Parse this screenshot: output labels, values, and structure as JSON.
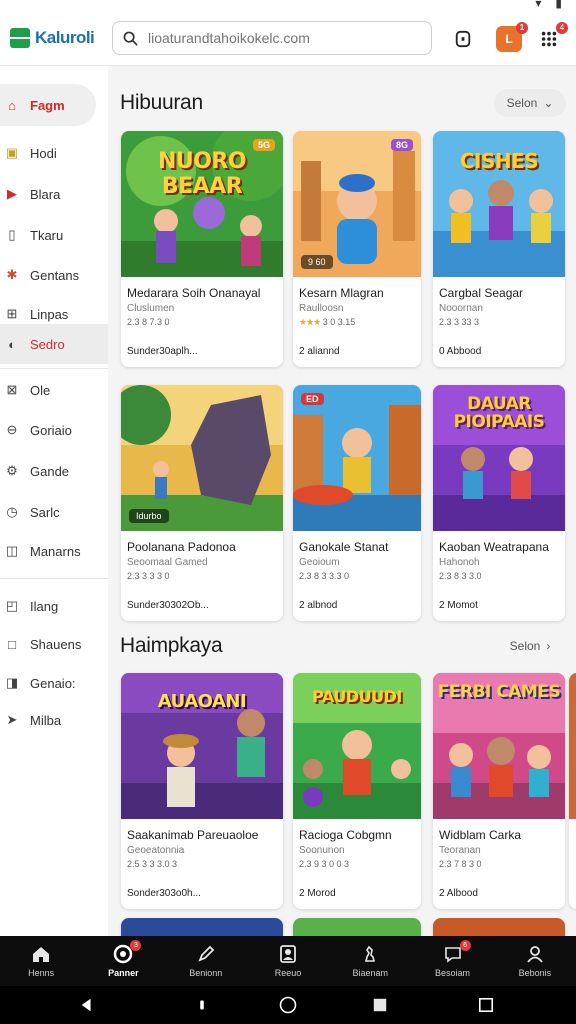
{
  "topbar": {
    "logo_text": "Kaluroli",
    "search_placeholder": "lioaturandtahoikokelc.com",
    "notif_badge": "1",
    "avatar_letter": "L",
    "menu_badge": "4"
  },
  "sidebar": {
    "items": [
      {
        "label": "Fagm",
        "icon": "home-icon"
      },
      {
        "label": "Hodi",
        "icon": "bookmark-icon"
      },
      {
        "label": "Blara",
        "icon": "play-icon"
      },
      {
        "label": "Tkaru",
        "icon": "list-icon"
      },
      {
        "label": "Gentans",
        "icon": "puzzle-icon"
      },
      {
        "label": "Linpas",
        "icon": "grid-icon"
      },
      {
        "label": "Sedro",
        "icon": "eye-icon"
      },
      {
        "label": "Ole",
        "icon": "target-icon"
      },
      {
        "label": "Goriaio",
        "icon": "link-icon"
      },
      {
        "label": "Gande",
        "icon": "gear-icon"
      },
      {
        "label": "Sarlc",
        "icon": "clock-icon"
      },
      {
        "label": "Manarns",
        "icon": "calendar-icon"
      },
      {
        "label": "Ilang",
        "icon": "chart-icon"
      },
      {
        "label": "Shauens",
        "icon": "square-icon"
      },
      {
        "label": "Genaio:",
        "icon": "box-icon"
      },
      {
        "label": "Milba",
        "icon": "send-icon"
      }
    ]
  },
  "sections": [
    {
      "title": "Hibuuran",
      "more_label": "Selon",
      "cards": [
        {
          "thumb_title": "NUORO BEAAR",
          "tag": "5G",
          "title": "Medarara Soih Onanayal",
          "sub": "Cluslumen",
          "rating": "2.3 8 7.3 0",
          "stars": "",
          "foot": "Sunder30aplh..."
        },
        {
          "thumb_title": "",
          "tag": "8G",
          "pill": "9 60",
          "title": "Kesarn Mlagran",
          "sub": "Raulloosn",
          "rating": "3 0 3.15",
          "stars": "★★★",
          "foot": "2 aliannd"
        },
        {
          "thumb_title": "CISHES",
          "tag": "",
          "title": "Cargbal Seagar",
          "sub": "Nooornan",
          "rating": "2.3 3 33 3",
          "stars": "",
          "foot": "0 Abbood"
        },
        {
          "thumb_title": "",
          "tag": "",
          "pill": "Idurbo",
          "title": "Poolanana Padonoa",
          "sub": "Seoomaal Gamed",
          "rating": "2.3 3 3 3 0",
          "stars": "",
          "foot": "Sunder30302Ob..."
        },
        {
          "thumb_title": "",
          "tag": "ED",
          "title": "Ganokale Stanat",
          "sub": "Geoioum",
          "rating": "2.3 8 3 3.3 0",
          "stars": "",
          "foot": "2 albnod"
        },
        {
          "thumb_title": "DAUAR PIOIPAAIS",
          "tag": "",
          "title": "Kaoban Weatrapana",
          "sub": "Hahonoh",
          "rating": "2.3 8 3 3.0",
          "stars": "",
          "foot": "2 Momot"
        }
      ]
    },
    {
      "title": "Haimpkaya",
      "more_label": "Selon",
      "cards": [
        {
          "thumb_title": "AUAOANI",
          "tag": "",
          "title": "Saakanimab Pareuaoloe",
          "sub": "Geoeatonnia",
          "rating": "2.5 3 3 3.0 3",
          "stars": "",
          "foot": "Sonder303o0h..."
        },
        {
          "thumb_title": "PAUDUUDI",
          "tag": "",
          "title": "Racioga Cobgmn",
          "sub": "Soonunon",
          "rating": "2.3 9 3 0 0 3",
          "stars": "",
          "foot": "2 Morod"
        },
        {
          "thumb_title": "FERBI CAMES",
          "tag": "",
          "title": "Widblam Carka",
          "sub": "Teoranan",
          "rating": "2.3 7 8 3 0",
          "stars": "",
          "foot": "2 Albood"
        }
      ]
    }
  ],
  "bottom_nav": [
    {
      "label": "Henns",
      "icon": "home-icon",
      "badge": ""
    },
    {
      "label": "Panner",
      "icon": "target-icon",
      "badge": "3"
    },
    {
      "label": "Benionn",
      "icon": "pen-icon",
      "badge": ""
    },
    {
      "label": "Reeuo",
      "icon": "portrait-icon",
      "badge": ""
    },
    {
      "label": "Biaenam",
      "icon": "chess-icon",
      "badge": ""
    },
    {
      "label": "Besoiam",
      "icon": "chat-icon",
      "badge": "6"
    },
    {
      "label": "Bebonis",
      "icon": "person-icon",
      "badge": ""
    }
  ],
  "colors": {
    "accent": "#d12a2a",
    "brand_green": "#1e9e48",
    "brand_blue": "#1e6fb5",
    "badge_red": "#e53935"
  }
}
